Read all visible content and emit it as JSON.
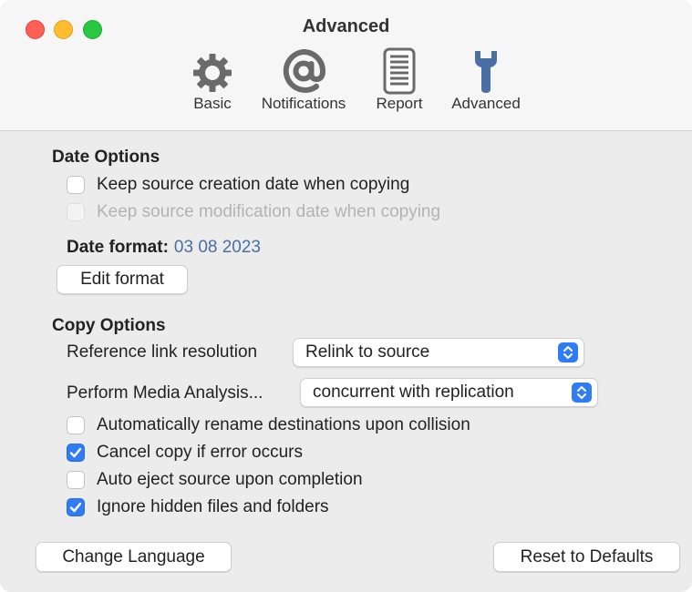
{
  "window": {
    "title": "Advanced"
  },
  "toolbar": {
    "items": [
      {
        "label": "Basic",
        "icon": "gear-icon"
      },
      {
        "label": "Notifications",
        "icon": "at-icon"
      },
      {
        "label": "Report",
        "icon": "document-icon"
      },
      {
        "label": "Advanced",
        "icon": "wrench-icon"
      }
    ]
  },
  "date_options": {
    "heading": "Date Options",
    "keep_creation_label": "Keep source creation date when copying",
    "keep_creation_checked": false,
    "keep_modification_label": "Keep source modification date when copying",
    "keep_modification_checked": false,
    "keep_modification_enabled": false,
    "date_format_label": "Date format:",
    "date_format_value": "03 08 2023",
    "edit_format_button": "Edit format"
  },
  "copy_options": {
    "heading": "Copy Options",
    "reference_link_label": "Reference link resolution",
    "reference_link_value": "Relink to source",
    "media_analysis_label": "Perform Media Analysis...",
    "media_analysis_value": "concurrent with replication",
    "checkboxes": [
      {
        "label": "Automatically rename destinations upon collision",
        "checked": false
      },
      {
        "label": "Cancel copy if error occurs",
        "checked": true
      },
      {
        "label": "Auto eject source upon completion",
        "checked": false
      },
      {
        "label": "Ignore hidden files and folders",
        "checked": true
      }
    ]
  },
  "footer": {
    "change_language_button": "Change Language",
    "reset_defaults_button": "Reset to Defaults"
  },
  "colors": {
    "accent": "#2f7cf6",
    "date_value": "#4a6fa5",
    "close": "#ff5f57",
    "minimize": "#febc2e",
    "maximize": "#28c840"
  }
}
